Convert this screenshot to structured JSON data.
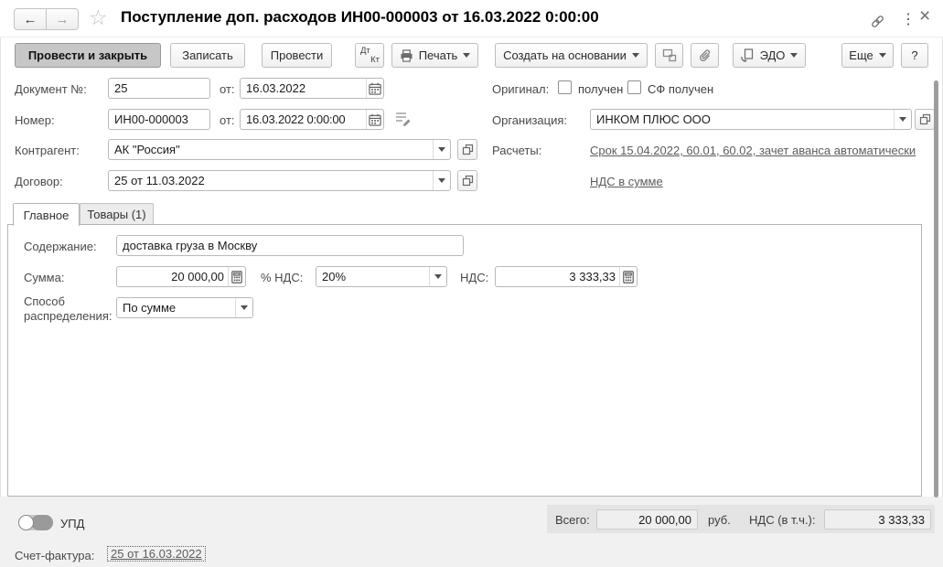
{
  "titlebar": {
    "title": "Поступление доп. расходов ИН00-000003 от 16.03.2022 0:00:00",
    "back_icon": "←",
    "forward_icon": "→",
    "star_icon": "☆",
    "more_icon": "⋮",
    "close_icon": "×"
  },
  "toolbar": {
    "post_and_close": "Провести и закрыть",
    "save": "Записать",
    "post": "Провести",
    "dtkt_dt": "Дт",
    "dtkt_kt": "Кт",
    "print": "Печать",
    "create_based_on": "Создать на основании",
    "edo": "ЭДО",
    "more": "Еще",
    "help": "?"
  },
  "form": {
    "doc_no_label": "Документ №:",
    "doc_no": "25",
    "doc_date_label": "от:",
    "doc_date": "16.03.2022",
    "original_label": "Оригинал:",
    "original_received": "получен",
    "sf_received": "СФ получен",
    "number_label": "Номер:",
    "number": "ИН00-000003",
    "number_date_label": "от:",
    "number_date": "16.03.2022  0:00:00",
    "organization_label": "Организация:",
    "organization": "ИНКОМ ПЛЮС ООО",
    "contractor_label": "Контрагент:",
    "contractor": "АК \"Россия\"",
    "settlements_label": "Расчеты:",
    "settlements_link": "Срок 15.04.2022, 60.01, 60.02, зачет аванса автоматически",
    "vat_mode_link": "НДС в сумме",
    "contract_label": "Договор:",
    "contract": "25 от 11.03.2022"
  },
  "tabs": [
    {
      "label": "Главное"
    },
    {
      "label": "Товары (1)"
    }
  ],
  "main": {
    "content_label": "Содержание:",
    "content": "доставка груза в Москву",
    "amount_label": "Сумма:",
    "amount": "20 000,00",
    "vat_rate_label": "% НДС:",
    "vat_rate": "20%",
    "vat_label": "НДС:",
    "vat_amount": "3 333,33",
    "distribution_label": "Способ распределения:",
    "distribution": "По сумме"
  },
  "footer": {
    "upd_label": "УПД",
    "total_label": "Всего:",
    "total": "20 000,00",
    "currency": "руб.",
    "vat_incl_label": "НДС (в т.ч.):",
    "vat_incl": "3 333,33",
    "invoice_label": "Счет-фактура:",
    "invoice_link": "25 от 16.03.2022"
  },
  "colors": {
    "primary_button_bg": "#c7c7c7",
    "panel_border": "#b5b5b5",
    "footer_bg": "#f1f1f1",
    "totals_bg": "#e4e4e4",
    "link_color": "#5c5c5c",
    "scrollbar": "#9d9d9d"
  }
}
